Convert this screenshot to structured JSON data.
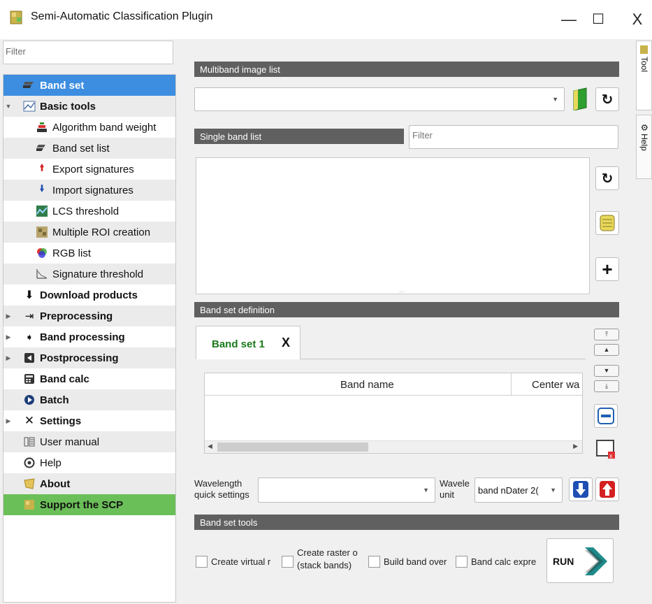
{
  "window": {
    "title": "Semi-Automatic Classification Plugin",
    "minimize_label": "—",
    "maximize_label": "☐",
    "close_label": "X"
  },
  "left_panel": {
    "filter_placeholder": "Filter",
    "tree": [
      {
        "label": "Band set",
        "icon": "band-set-icon",
        "bold": true,
        "selected": true
      },
      {
        "label": "Basic tools",
        "icon": "basic-tools-icon",
        "bold": true,
        "expanded": true
      },
      {
        "label": "Algorithm band weight",
        "icon": "algorithm-band-weight-icon"
      },
      {
        "label": "Band set list",
        "icon": "band-set-list-icon"
      },
      {
        "label": "Export signatures",
        "icon": "export-signatures-icon"
      },
      {
        "label": "Import signatures",
        "icon": "import-signatures-icon"
      },
      {
        "label": "LCS threshold",
        "icon": "lcs-threshold-icon"
      },
      {
        "label": "Multiple ROI creation",
        "icon": "multiple-roi-icon"
      },
      {
        "label": "RGB list",
        "icon": "rgb-list-icon"
      },
      {
        "label": "Signature threshold",
        "icon": "signature-threshold-icon"
      },
      {
        "label": "Download products",
        "icon": "download-icon",
        "bold": true
      },
      {
        "label": "Preprocessing",
        "icon": "preprocessing-icon",
        "bold": true
      },
      {
        "label": "Band processing",
        "icon": "band-processing-icon",
        "bold": true
      },
      {
        "label": "Postprocessing",
        "icon": "postprocessing-icon",
        "bold": true
      },
      {
        "label": "Band calc",
        "icon": "band-calc-icon",
        "bold": true
      },
      {
        "label": "Batch",
        "icon": "batch-icon",
        "bold": true
      },
      {
        "label": "Settings",
        "icon": "settings-icon",
        "bold": true
      },
      {
        "label": "User manual",
        "icon": "user-manual-icon"
      },
      {
        "label": "Help",
        "icon": "help-icon"
      },
      {
        "label": "About",
        "icon": "about-icon",
        "bold": true
      },
      {
        "label": "Support the SCP",
        "icon": "support-icon",
        "bold": true,
        "green": true
      }
    ]
  },
  "side_tabs": {
    "tool": "Tool",
    "help": "Help"
  },
  "main": {
    "multiband_title": "Multiband image list",
    "single_band_title": "Single band list",
    "single_band_filter_placeholder": "Filter",
    "band_set_definition_title": "Band set definition",
    "band_set_tab": "Band set 1",
    "band_set_tab_close": "X",
    "table_headers": [
      "Band name",
      "Center wa"
    ],
    "wavelength_quick_label": "Wavelength quick settings",
    "wavelength_unit_label": "Wavele unit",
    "band_number_value": "band nDater 2(",
    "band_set_tools_title": "Band set tools",
    "options": [
      {
        "label": "Create virtual r"
      },
      {
        "label": "Create raster o (stack bands)"
      },
      {
        "label": "Build band over"
      },
      {
        "label": "Band calc expre"
      }
    ],
    "run_label": "RUN"
  },
  "colors": {
    "selection": "#3d8ee0",
    "support_green": "#6bbf59",
    "section_bar": "#606060"
  }
}
